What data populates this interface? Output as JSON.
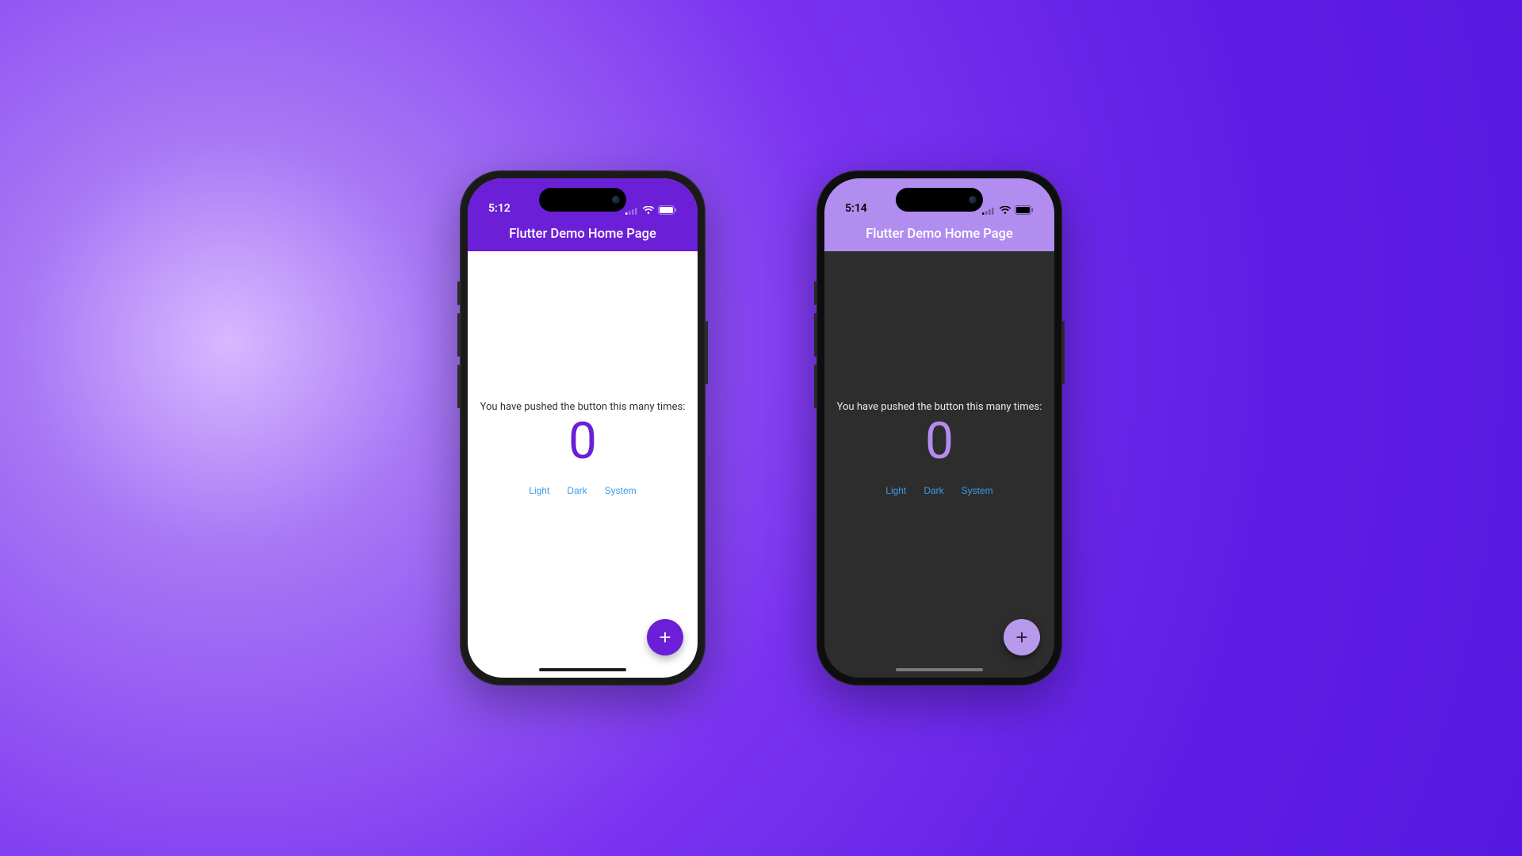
{
  "phones": {
    "light": {
      "status": {
        "time": "5:12"
      },
      "appbar": {
        "title": "Flutter Demo Home Page"
      },
      "body": {
        "prompt": "You have pushed the button this many times:",
        "counter": "0",
        "theme_buttons": {
          "light": "Light",
          "dark": "Dark",
          "system": "System"
        }
      },
      "colors": {
        "appbar_bg": "#6b1fd6",
        "body_bg": "#ffffff",
        "accent": "#6b1fd6",
        "fab_bg": "#6b1fd6",
        "fab_fg": "#ffffff"
      }
    },
    "dark": {
      "status": {
        "time": "5:14"
      },
      "appbar": {
        "title": "Flutter Demo Home Page"
      },
      "body": {
        "prompt": "You have pushed the button this many times:",
        "counter": "0",
        "theme_buttons": {
          "light": "Light",
          "dark": "Dark",
          "system": "System"
        }
      },
      "colors": {
        "appbar_bg": "#b18df0",
        "body_bg": "#2d2d2d",
        "accent": "#b18df0",
        "fab_bg": "#b79aeb",
        "fab_fg": "#2a1140"
      }
    }
  },
  "icons": {
    "cellular": "cellular-icon",
    "wifi": "wifi-icon",
    "battery": "battery-icon",
    "plus": "plus-icon"
  }
}
